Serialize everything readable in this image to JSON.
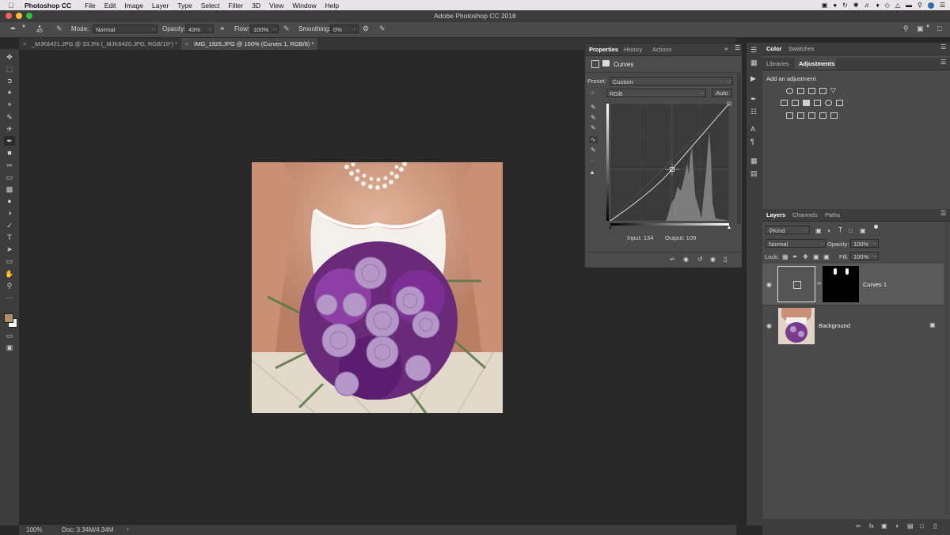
{
  "menubar": {
    "app_name": "Photoshop CC",
    "items": [
      "File",
      "Edit",
      "Image",
      "Layer",
      "Type",
      "Select",
      "Filter",
      "3D",
      "View",
      "Window",
      "Help"
    ]
  },
  "window": {
    "title": "Adobe Photoshop CC 2018"
  },
  "options_bar": {
    "brush_size": "45",
    "mode_label": "Mode:",
    "mode_value": "Normal",
    "opacity_label": "Opacity:",
    "opacity_value": "43%",
    "flow_label": "Flow:",
    "flow_value": "100%",
    "smoothing_label": "Smoothing:",
    "smoothing_value": "0%"
  },
  "tabs": [
    {
      "label": "_MJK6421.JPG @ 33.3% (_MJK6420.JPG, RGB/16*) *"
    },
    {
      "label": "IMG_1926.JPG @ 100% (Curves 1, RGB/8) *"
    }
  ],
  "status": {
    "zoom": "100%",
    "doc": "Doc: 3.34M/4.34M"
  },
  "properties": {
    "tabs": [
      "Properties",
      "History",
      "Actions"
    ],
    "title": "Curves",
    "preset_label": "Preset:",
    "preset_value": "Custom",
    "channel_value": "RGB",
    "auto_label": "Auto",
    "input_label": "Input: 134",
    "output_label": "Output: 109"
  },
  "color_panel": {
    "tabs": [
      "Color",
      "Swatches"
    ]
  },
  "adjustments_panel": {
    "tabs": [
      "Libraries",
      "Adjustments"
    ],
    "heading": "Add an adjustment"
  },
  "layers_panel": {
    "tabs": [
      "Layers",
      "Channels",
      "Paths"
    ],
    "filter_value": "Kind",
    "blend_value": "Normal",
    "opacity_label": "Opacity:",
    "opacity_value": "100%",
    "lock_label": "Lock:",
    "fill_label": "Fill:",
    "fill_value": "100%",
    "layers": [
      {
        "name": "Curves 1"
      },
      {
        "name": "Background"
      }
    ]
  },
  "colors": {
    "accent": "#2d8ceb",
    "foreground_swatch": "#b0926a",
    "background_swatch": "#ffffff"
  }
}
